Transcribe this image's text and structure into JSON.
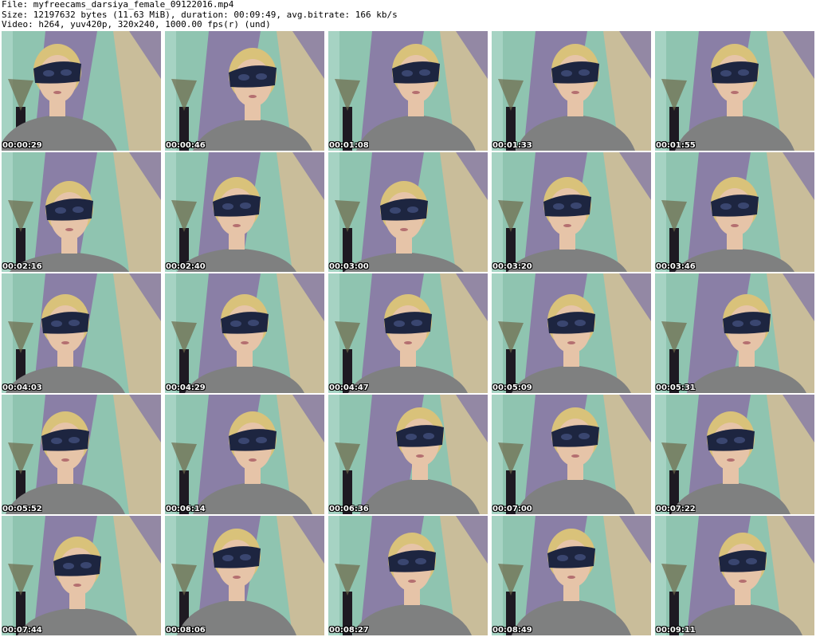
{
  "header": {
    "file_line": "File: myfreecams_darsiya_female_09122016.mp4",
    "size_line": "Size: 12197632 bytes (11.63 MiB), duration: 00:09:49, avg.bitrate: 166 kb/s",
    "video_line": "Video: h264, yuv420p, 320x240, 1000.00 fps(r) (und)"
  },
  "thumbnails": [
    {
      "timestamp": "00:00:29"
    },
    {
      "timestamp": "00:00:46"
    },
    {
      "timestamp": "00:01:08"
    },
    {
      "timestamp": "00:01:33"
    },
    {
      "timestamp": "00:01:55"
    },
    {
      "timestamp": "00:02:16"
    },
    {
      "timestamp": "00:02:40"
    },
    {
      "timestamp": "00:03:00"
    },
    {
      "timestamp": "00:03:20"
    },
    {
      "timestamp": "00:03:46"
    },
    {
      "timestamp": "00:04:03"
    },
    {
      "timestamp": "00:04:29"
    },
    {
      "timestamp": "00:04:47"
    },
    {
      "timestamp": "00:05:09"
    },
    {
      "timestamp": "00:05:31"
    },
    {
      "timestamp": "00:05:52"
    },
    {
      "timestamp": "00:06:14"
    },
    {
      "timestamp": "00:06:36"
    },
    {
      "timestamp": "00:07:00"
    },
    {
      "timestamp": "00:07:22"
    },
    {
      "timestamp": "00:07:44"
    },
    {
      "timestamp": "00:08:06"
    },
    {
      "timestamp": "00:08:27"
    },
    {
      "timestamp": "00:08:49"
    },
    {
      "timestamp": "00:09:11"
    }
  ],
  "colors": {
    "wall": "#8fc4b0",
    "curtain": "#8a7fa6",
    "drape": "#c9bd9a",
    "shirt": "#7f8080",
    "hair": "#d9c27a",
    "skin": "#e6c4a8",
    "mask": "#1d2540"
  }
}
